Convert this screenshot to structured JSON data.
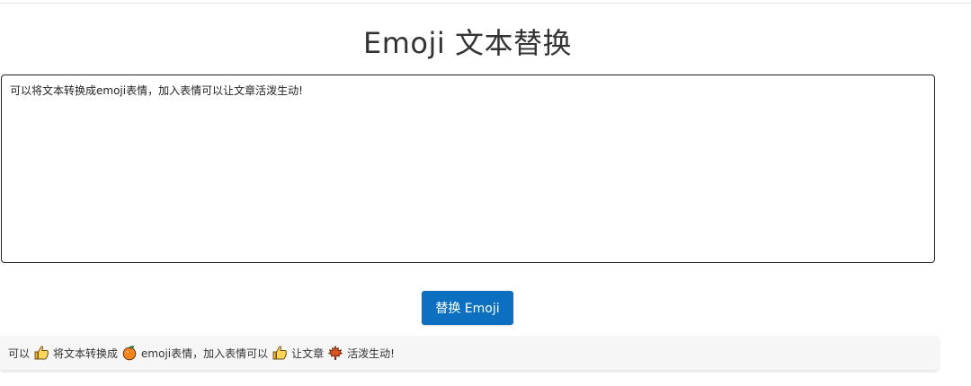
{
  "page": {
    "title": "Emoji 文本替换"
  },
  "editor": {
    "value": "可以将文本转换成emoji表情，加入表情可以让文章活泼生动!"
  },
  "actions": {
    "replace_label": "替换 Emoji"
  },
  "result": {
    "segments": [
      {
        "text": "可以"
      },
      {
        "icon": "thumbs-up-icon"
      },
      {
        "text": "将文本转换成"
      },
      {
        "icon": "orange-fruit-icon"
      },
      {
        "text": "emoji表情，加入表情可以"
      },
      {
        "icon": "thumbs-up-icon"
      },
      {
        "text": "让文章"
      },
      {
        "icon": "maple-leaf-icon"
      },
      {
        "text": "活泼生动!"
      }
    ]
  },
  "colors": {
    "accent": "#0d6fc0",
    "result_bg": "#f6f6f6",
    "editor_border": "#222222"
  }
}
